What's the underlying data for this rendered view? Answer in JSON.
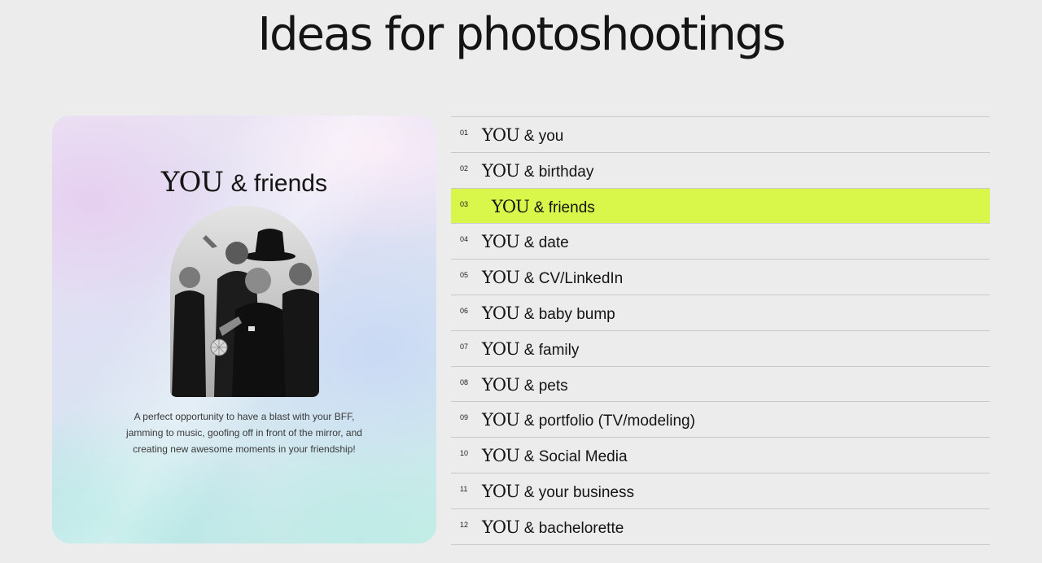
{
  "page": {
    "title": "Ideas for photoshootings"
  },
  "feature": {
    "brand": "YOU",
    "suffix": "& friends",
    "description": "A perfect opportunity to have a blast with your BFF, jamming to music, goofing off in front of the mirror, and creating new awesome moments in your friendship!"
  },
  "ideas": [
    {
      "num": "01",
      "brand": "YOU",
      "label": "& you"
    },
    {
      "num": "02",
      "brand": "YOU",
      "label": "& birthday"
    },
    {
      "num": "03",
      "brand": "YOU",
      "label": "& friends"
    },
    {
      "num": "04",
      "brand": "YOU",
      "label": "& date"
    },
    {
      "num": "05",
      "brand": "YOU",
      "label": "& CV/LinkedIn"
    },
    {
      "num": "06",
      "brand": "YOU",
      "label": "& baby bump"
    },
    {
      "num": "07",
      "brand": "YOU",
      "label": "& family"
    },
    {
      "num": "08",
      "brand": "YOU",
      "label": "& pets"
    },
    {
      "num": "09",
      "brand": "YOU",
      "label": "& portfolio (TV/modeling)"
    },
    {
      "num": "10",
      "brand": "YOU",
      "label": "& Social Media"
    },
    {
      "num": "11",
      "brand": "YOU",
      "label": "& your business"
    },
    {
      "num": "12",
      "brand": "YOU",
      "label": "& bachelorette"
    }
  ],
  "colors": {
    "active_highlight": "#d8f74a",
    "background": "#ececec",
    "text": "#141414"
  },
  "icons": {
    "photo": "friends-group-photo"
  }
}
